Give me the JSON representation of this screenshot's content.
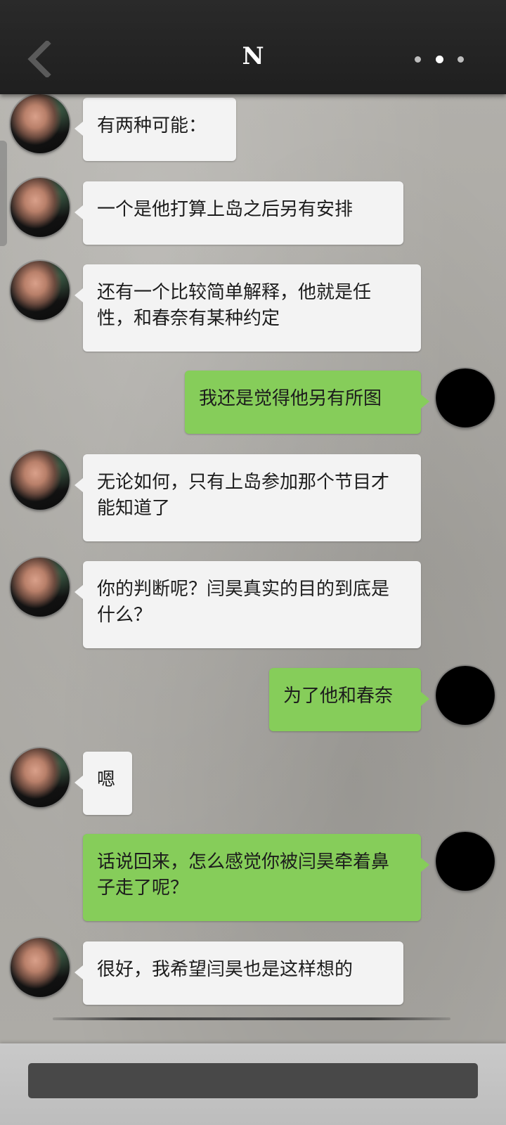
{
  "header": {
    "title": "N",
    "back_icon": "chevron-left-icon",
    "more_icon": "more-dots-icon"
  },
  "messages": [
    {
      "side": "in",
      "text": "有两种可能："
    },
    {
      "side": "in",
      "text": "一个是他打算上岛之后另有安排"
    },
    {
      "side": "in",
      "text": "还有一个比较简单解释，他就是任性，和春奈有某种约定"
    },
    {
      "side": "out",
      "text": "我还是觉得他另有所图"
    },
    {
      "side": "in",
      "text": "无论如何，只有上岛参加那个节目才能知道了"
    },
    {
      "side": "in",
      "text": "你的判断呢？闫昊真实的目的到底是什么？"
    },
    {
      "side": "out",
      "text": "为了他和春奈"
    },
    {
      "side": "in",
      "text": "嗯"
    },
    {
      "side": "out",
      "text": "话说回来，怎么感觉你被闫昊牵着鼻子走了呢？"
    },
    {
      "side": "in",
      "text": "很好，我希望闫昊也是这样想的"
    }
  ],
  "input": {
    "value": "",
    "placeholder": ""
  },
  "colors": {
    "topbar": "#1f1f1f",
    "incoming_bubble": "#f3f3f3",
    "outgoing_bubble": "#86cd5a",
    "input_field": "#484848"
  }
}
